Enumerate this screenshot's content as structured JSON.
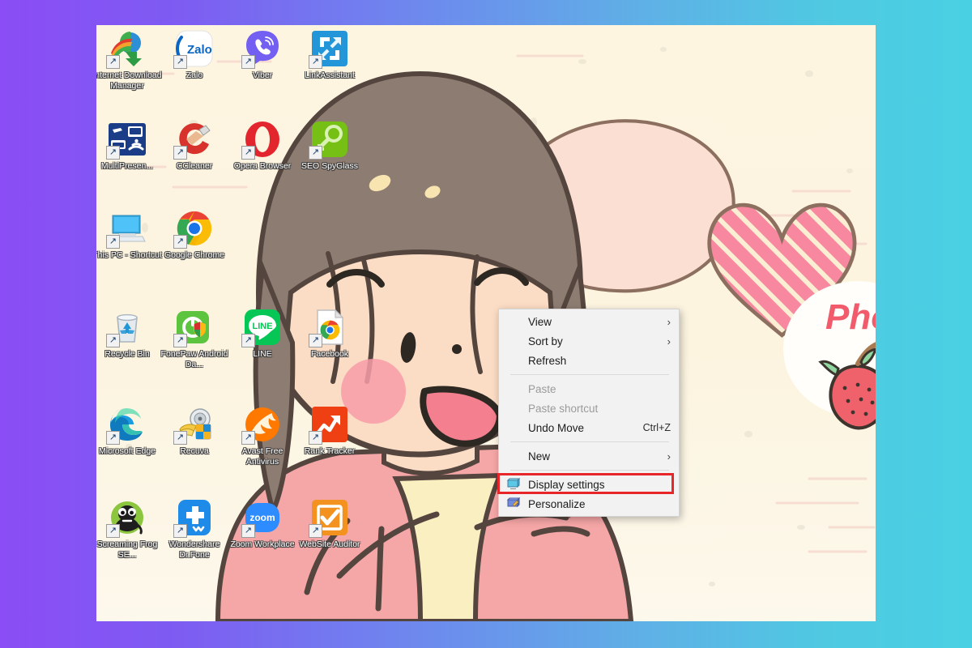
{
  "background": {
    "gradient_from": "#8B4DF5",
    "gradient_to": "#49D0E3"
  },
  "desktop": {
    "wallpaper": {
      "background_color": "#FDF5E0",
      "description_text": "Pho",
      "text_color": "#F15B6C",
      "character_hair_color": "#8D7C71",
      "character_skin_color": "#FBDCC4",
      "character_clothes_color": "#F5A6A6",
      "speech_bubble_fill": "#FADFD2",
      "heart_color": "#F8889F"
    },
    "icons": [
      {
        "name": "internet-download-manager",
        "label": "Internet Download Manager",
        "type": "idm",
        "col": 0,
        "row": 0
      },
      {
        "name": "zalo",
        "label": "Zalo",
        "type": "zalo",
        "col": 1,
        "row": 0
      },
      {
        "name": "viber",
        "label": "Viber",
        "type": "viber",
        "col": 2,
        "row": 0
      },
      {
        "name": "linkassistant",
        "label": "LinkAssistant",
        "type": "linkassistant",
        "col": 3,
        "row": 0
      },
      {
        "name": "multipresenter",
        "label": "MultiPresen...",
        "type": "multipresenter",
        "col": 0,
        "row": 1
      },
      {
        "name": "ccleaner",
        "label": "CCleaner",
        "type": "ccleaner",
        "col": 1,
        "row": 1
      },
      {
        "name": "opera-browser",
        "label": "Opera Browser",
        "type": "opera",
        "col": 2,
        "row": 1
      },
      {
        "name": "seo-spyglass",
        "label": "SEO SpyGlass",
        "type": "spyglass",
        "col": 3,
        "row": 1
      },
      {
        "name": "this-pc-shortcut",
        "label": "This PC - Shortcut",
        "type": "thispc",
        "col": 0,
        "row": 2
      },
      {
        "name": "google-chrome",
        "label": "Google Chrome",
        "type": "chrome",
        "col": 1,
        "row": 2
      },
      {
        "name": "recycle-bin",
        "label": "Recycle Bin",
        "type": "recyclebin",
        "col": 0,
        "row": 3
      },
      {
        "name": "fonepaw-android",
        "label": "FonePaw Android Da...",
        "type": "fonepaw",
        "col": 1,
        "row": 3
      },
      {
        "name": "line",
        "label": "LINE",
        "type": "line",
        "col": 2,
        "row": 3
      },
      {
        "name": "facebook",
        "label": "Facebook",
        "type": "facebook",
        "col": 3,
        "row": 3
      },
      {
        "name": "microsoft-edge",
        "label": "Microsoft Edge",
        "type": "edge",
        "col": 0,
        "row": 4
      },
      {
        "name": "recuva",
        "label": "Recuva",
        "type": "recuva",
        "col": 1,
        "row": 4
      },
      {
        "name": "avast-free-antivirus",
        "label": "Avast Free Antivirus",
        "type": "avast",
        "col": 2,
        "row": 4
      },
      {
        "name": "rank-tracker",
        "label": "Rank Tracker",
        "type": "ranktracker",
        "col": 3,
        "row": 4
      },
      {
        "name": "screaming-frog-seo",
        "label": "Screaming Frog SE...",
        "type": "screamingfrog",
        "col": 0,
        "row": 5
      },
      {
        "name": "wondershare-drfone",
        "label": "Wondershare Dr.Fone",
        "type": "drfone",
        "col": 1,
        "row": 5
      },
      {
        "name": "zoom-workplace",
        "label": "Zoom Workplace",
        "type": "zoom",
        "col": 2,
        "row": 5
      },
      {
        "name": "website-auditor",
        "label": "WebSite Auditor",
        "type": "websiteauditor",
        "col": 3,
        "row": 5
      }
    ]
  },
  "context_menu": {
    "highlight_color": "#E8262A",
    "highlighted_item": "Display settings",
    "items": [
      {
        "id": "view",
        "label": "View",
        "submenu": true,
        "disabled": false,
        "accel": "",
        "icon": ""
      },
      {
        "id": "sort-by",
        "label": "Sort by",
        "submenu": true,
        "disabled": false,
        "accel": "",
        "icon": ""
      },
      {
        "id": "refresh",
        "label": "Refresh",
        "submenu": false,
        "disabled": false,
        "accel": "",
        "icon": ""
      },
      {
        "id": "separator-1",
        "label": "",
        "separator": true
      },
      {
        "id": "paste",
        "label": "Paste",
        "submenu": false,
        "disabled": true,
        "accel": "",
        "icon": ""
      },
      {
        "id": "paste-shortcut",
        "label": "Paste shortcut",
        "submenu": false,
        "disabled": true,
        "accel": "",
        "icon": ""
      },
      {
        "id": "undo-move",
        "label": "Undo Move",
        "submenu": false,
        "disabled": false,
        "accel": "Ctrl+Z",
        "icon": ""
      },
      {
        "id": "separator-2",
        "label": "",
        "separator": true
      },
      {
        "id": "new",
        "label": "New",
        "submenu": true,
        "disabled": false,
        "accel": "",
        "icon": ""
      },
      {
        "id": "separator-3",
        "label": "",
        "separator": true
      },
      {
        "id": "display-settings",
        "label": "Display settings",
        "submenu": false,
        "disabled": false,
        "accel": "",
        "icon": "monitor-icon"
      },
      {
        "id": "personalize",
        "label": "Personalize",
        "submenu": false,
        "disabled": false,
        "accel": "",
        "icon": "monitor-brush-icon"
      }
    ],
    "submenu_glyph": "›"
  }
}
